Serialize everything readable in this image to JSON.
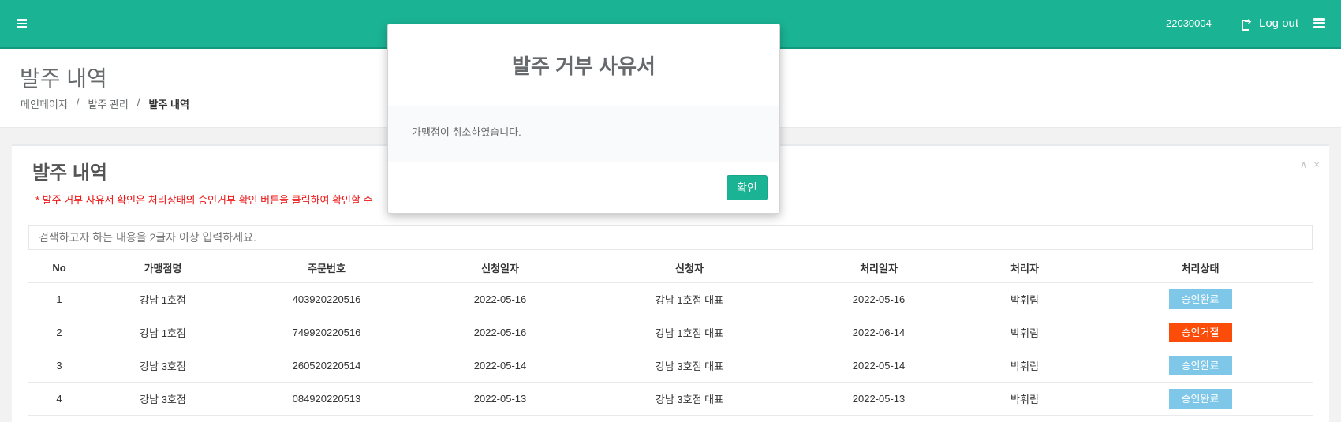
{
  "topbar": {
    "user_id": "22030004",
    "logout_label": "Log out"
  },
  "header": {
    "title": "발주 내역",
    "breadcrumb": [
      "메인페이지",
      "발주 관리",
      "발주 내역"
    ],
    "separator": "/"
  },
  "panel": {
    "title": "발주 내역",
    "notice": "* 발주 거부 사유서 확인은 처리상태의 승인거부 확인 버튼을 클릭하여 확인할 수",
    "search_placeholder": "검색하고자 하는 내용을 2글자 이상 입력하세요.",
    "tools": [
      "∧",
      "×"
    ]
  },
  "table": {
    "headers": [
      "No",
      "가맹점명",
      "주문번호",
      "신청일자",
      "신청자",
      "처리일자",
      "처리자",
      "처리상태"
    ],
    "rows": [
      {
        "no": "1",
        "store": "강남 1호점",
        "order": "403920220516",
        "req_date": "2022-05-16",
        "requester": "강남 1호점 대표",
        "proc_date": "2022-05-16",
        "processor": "박휘림",
        "status": "승인완료",
        "status_type": "ok"
      },
      {
        "no": "2",
        "store": "강남 1호점",
        "order": "749920220516",
        "req_date": "2022-05-16",
        "requester": "강남 1호점 대표",
        "proc_date": "2022-06-14",
        "processor": "박휘림",
        "status": "승인거절",
        "status_type": "rej"
      },
      {
        "no": "3",
        "store": "강남 3호점",
        "order": "260520220514",
        "req_date": "2022-05-14",
        "requester": "강남 3호점 대표",
        "proc_date": "2022-05-14",
        "processor": "박휘림",
        "status": "승인완료",
        "status_type": "ok"
      },
      {
        "no": "4",
        "store": "강남 3호점",
        "order": "084920220513",
        "req_date": "2022-05-13",
        "requester": "강남 3호점 대표",
        "proc_date": "2022-05-13",
        "processor": "박휘림",
        "status": "승인완료",
        "status_type": "ok"
      }
    ]
  },
  "modal": {
    "title": "발주 거부 사유서",
    "message": "가맹점이 취소하였습니다.",
    "confirm_label": "확인"
  },
  "colors": {
    "primary": "#1ab394",
    "status_ok": "#7ec7e8",
    "status_rejected": "#fb4c0a",
    "notice": "#ed1515"
  }
}
